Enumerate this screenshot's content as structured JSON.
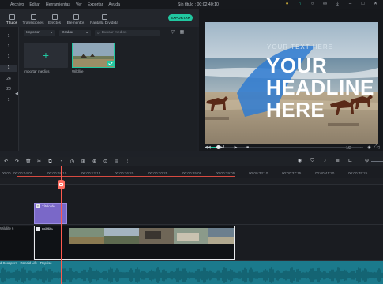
{
  "menu": [
    "Archivo",
    "Editar",
    "Herramientas",
    "Ver",
    "Exportar",
    "Ayuda"
  ],
  "window_title": "Sin título : 00:02:40:10",
  "tabs": [
    {
      "label": "Títulos",
      "icon": "text-icon"
    },
    {
      "label": "Transiciones",
      "icon": "transition-icon"
    },
    {
      "label": "Efectos",
      "icon": "effects-icon"
    },
    {
      "label": "Elementos",
      "icon": "elements-icon"
    },
    {
      "label": "Pantalla Dividida",
      "icon": "split-screen-icon"
    }
  ],
  "export_label": "EXPORTAR",
  "rail_items": [
    "1",
    "1",
    "1",
    "1",
    "24",
    "20",
    "1"
  ],
  "media": {
    "filter_import": "Importar",
    "filter_record": "Grabar",
    "search_placeholder": "Buscar medios",
    "import_label": "Importar medios",
    "clip_label": "Wildlife"
  },
  "preview": {
    "headline_line1": "YOUR",
    "headline_line2": "HEADLINE",
    "headline_line3": "HERE",
    "subtext": "YOUR TEXT HERE",
    "page": "1/2",
    "progress": 0.08
  },
  "ruler_ticks": [
    "00:00",
    "00:00:04:05",
    "00:00:08:10",
    "00:00:12:15",
    "00:00:16:20",
    "00:00:20:25",
    "00:00:25:08",
    "00:00:29:05",
    "00:00:33:10",
    "00:00:37:15",
    "00:00:41:20",
    "00:00:45:25"
  ],
  "tracks": {
    "title_clip": "Título de",
    "video_clip": "Wildlife",
    "video_track_label": "Wildlife 6",
    "audio_label": "d Scoopers - Rancid Life - Reprise"
  },
  "colors": {
    "accent": "#21c7a0",
    "playhead": "#ff5a4e",
    "title_clip": "#7a68c8",
    "audio": "#1b7a8c"
  }
}
